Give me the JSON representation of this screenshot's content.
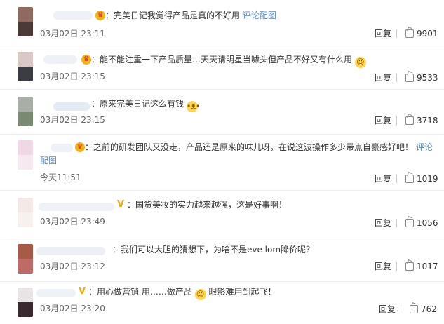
{
  "comments": [
    {
      "text_before": "：完美日记我觉得产品是真的不好用",
      "link": "评论配图",
      "text_after": "",
      "time": "03月02日 23:11",
      "reply": "回复",
      "likes": "9901"
    },
    {
      "text_before": "：能不能注重一下产品质量…天天请明星当噱头但产品不好又有什么用",
      "link": "",
      "text_after": "",
      "time": "03月02日 23:15",
      "reply": "回复",
      "likes": "9533"
    },
    {
      "text_before": "：原来完美日记这么有钱",
      "link": "",
      "text_after": "",
      "time": "03月02日 23:15",
      "reply": "回复",
      "likes": "3718"
    },
    {
      "text_before": "：之前的研发团队又没走，产品还是原来的味儿呀，在说这波操作多少带点自豪感好吧！",
      "link": "评论",
      "link2": "配图",
      "text_after": "",
      "time": "今天11:51",
      "reply": "回复",
      "likes": "1019"
    },
    {
      "text_before": "：国货美妆的实力越来越强，这是好事啊！",
      "link": "",
      "text_after": "",
      "time": "03月02日 23:49",
      "reply": "回复",
      "likes": "1056"
    },
    {
      "text_before": "：我们可以大胆的猜想下，为啥不是eve lom降价呢？",
      "link": "",
      "text_after": "",
      "time": "03月02日 23:12",
      "reply": "回复",
      "likes": "1017"
    },
    {
      "text_before": "：用心做营销 用……做产品",
      "text_mid": " 眼影难用到起飞！",
      "link": "",
      "text_after": "",
      "time": "03月02日 23:20",
      "reply": "回复",
      "likes": "762"
    }
  ],
  "colors": {
    "link": "#5a8ac6",
    "crown": "#f2b31c",
    "vbadge": "#f5a40a"
  },
  "icons": {
    "like": "thumbs-up-icon",
    "member": "crown-icon",
    "verified": "v-badge-icon",
    "emoji": "smiley-icon"
  }
}
